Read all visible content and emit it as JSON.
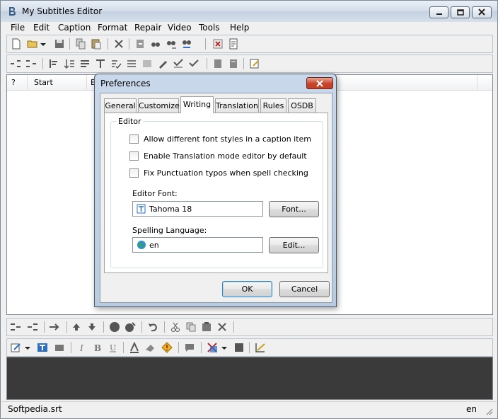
{
  "window": {
    "title": "My Subtitles Editor"
  },
  "menu": [
    "File",
    "Edit",
    "Caption",
    "Format",
    "Repair",
    "Video",
    "Tools",
    "Help"
  ],
  "list": {
    "columns": [
      "?",
      "Start",
      "E"
    ]
  },
  "status": {
    "file": "Softpedia.srt",
    "language": "en"
  },
  "dialog": {
    "title": "Preferences",
    "tabs": [
      "General",
      "Customize",
      "Writing",
      "Translation",
      "Rules",
      "OSDB"
    ],
    "active_tab": "Writing",
    "group_label": "Editor",
    "checkboxes": [
      {
        "label": "Allow different font styles in a caption item",
        "checked": false
      },
      {
        "label": "Enable Translation mode editor by default",
        "checked": false
      },
      {
        "label": "Fix Punctuation typos when spell checking",
        "checked": false
      }
    ],
    "font_label": "Editor Font:",
    "font_value": "Tahoma 18",
    "font_button": "Font...",
    "lang_label": "Spelling Language:",
    "lang_value": "en",
    "lang_button": "Edit...",
    "ok_label": "OK",
    "cancel_label": "Cancel"
  },
  "colors": {
    "editor_background": "#3a3a3a",
    "accent": "#3c7fb1",
    "close_red": "#c7432a"
  },
  "icons": {
    "toolbar1": [
      "new-file-icon",
      "open-folder-icon",
      "dropdown-arrow-icon",
      "save-icon",
      "copy-icon",
      "paste-icon",
      "delete-icon",
      "import-icon",
      "find-icon",
      "find-next-icon",
      "replace-icon",
      "stop-icon",
      "properties-icon"
    ],
    "toolbar2": [
      "split-icon",
      "join-icon",
      "align-icon",
      "sort-icon",
      "timing-icon",
      "format-icon",
      "check-icon",
      "spell-icon",
      "spell-check-icon",
      "book-icon",
      "book2-icon",
      "notes-icon",
      "edit-icon"
    ],
    "toolbar3": [
      "insert-before-icon",
      "insert-after-icon",
      "move-icon",
      "up-arrow-icon",
      "down-arrow-icon",
      "record-icon",
      "tag-icon",
      "undo-icon",
      "cut-icon",
      "copy-icon",
      "paste-icon",
      "delete-icon"
    ],
    "toolbar4": [
      "edit-icon",
      "dropdown-arrow-icon",
      "text-icon",
      "video-icon",
      "italic-icon",
      "bold-icon",
      "underline-icon",
      "font-color-icon",
      "eraser-icon",
      "warning-icon",
      "comment-icon",
      "translate-icon",
      "dropdown-arrow-icon",
      "square-icon",
      "chart-icon"
    ]
  }
}
